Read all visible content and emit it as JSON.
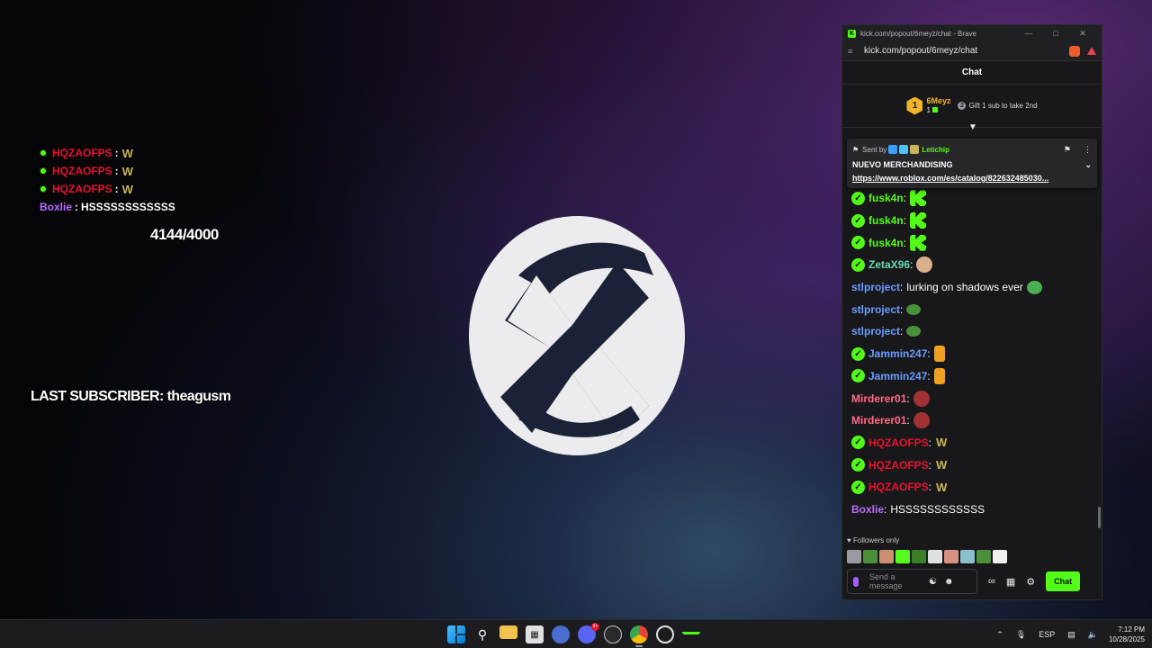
{
  "overlay": {
    "chat_lines": [
      {
        "user": "HQZAOFPS",
        "sep": ":",
        "emote": "W"
      },
      {
        "user": "HQZAOFPS",
        "sep": ":",
        "emote": "W"
      },
      {
        "user": "HQZAOFPS",
        "sep": ":",
        "emote": "W"
      }
    ],
    "last_line": {
      "user": "Boxlie",
      "sep": ":",
      "text": "HSSSSSSSSSSSS"
    },
    "counter": "4144/4000",
    "last_subscriber": "LAST SUBSCRIBER: theagusm"
  },
  "window": {
    "title": "kick.com/popout/6meyz/chat - Brave",
    "url": "kick.com/popout/6meyz/chat",
    "chat_header": "Chat"
  },
  "gift": {
    "rank": "1",
    "user": "6Meyz",
    "count": "1",
    "cta": "Gift 1 sub to take 2nd"
  },
  "pinned": {
    "sent_by_label": "Sent by",
    "sender": "Letichip",
    "title": "NUEVO MERCHANDISING",
    "link": "https://www.roblox.com/es/catalog/822632485030..."
  },
  "messages": [
    {
      "user": "fusk4n",
      "verified": true,
      "color": "green",
      "emote": "kick",
      "text": ""
    },
    {
      "user": "fusk4n",
      "verified": true,
      "color": "green",
      "emote": "kick",
      "text": ""
    },
    {
      "user": "fusk4n",
      "verified": true,
      "color": "green",
      "emote": "kick",
      "text": ""
    },
    {
      "user": "ZetaX96",
      "verified": true,
      "color": "teal",
      "emote": "cat",
      "text": ""
    },
    {
      "user": "stlproject",
      "verified": false,
      "color": "blue",
      "emote": "heart",
      "text": "lurking on shadows ever"
    },
    {
      "user": "stlproject",
      "verified": false,
      "color": "blue",
      "emote": "pepe",
      "text": ""
    },
    {
      "user": "stlproject",
      "verified": false,
      "color": "blue",
      "emote": "pepe",
      "text": ""
    },
    {
      "user": "Jammin247",
      "verified": true,
      "color": "blue",
      "emote": "fire",
      "text": ""
    },
    {
      "user": "Jammin247",
      "verified": true,
      "color": "blue",
      "emote": "fire",
      "text": ""
    },
    {
      "user": "Mirderer01",
      "verified": false,
      "color": "pink",
      "emote": "dog",
      "text": ""
    },
    {
      "user": "Mirderer01",
      "verified": false,
      "color": "pink",
      "emote": "dog",
      "text": ""
    },
    {
      "user": "HQZAOFPS",
      "verified": true,
      "color": "red",
      "emote": "w",
      "text": ""
    },
    {
      "user": "HQZAOFPS",
      "verified": true,
      "color": "red",
      "emote": "w",
      "text": ""
    },
    {
      "user": "HQZAOFPS",
      "verified": true,
      "color": "red",
      "emote": "w",
      "text": ""
    },
    {
      "user": "Boxlie",
      "verified": false,
      "color": "purple",
      "emote": "",
      "text": "HSSSSSSSSSSSS"
    }
  ],
  "footer": {
    "followers_only": "Followers only",
    "placeholder": "Send a message",
    "chat_button": "Chat"
  },
  "taskbar": {
    "lang": "ESP",
    "time": "7:12 PM",
    "date": "10/28/2025",
    "discord_badge": "9+"
  },
  "colors": {
    "kick_green": "#53fc18",
    "red_user": "#e8142e",
    "purple_user": "#b86cff"
  }
}
